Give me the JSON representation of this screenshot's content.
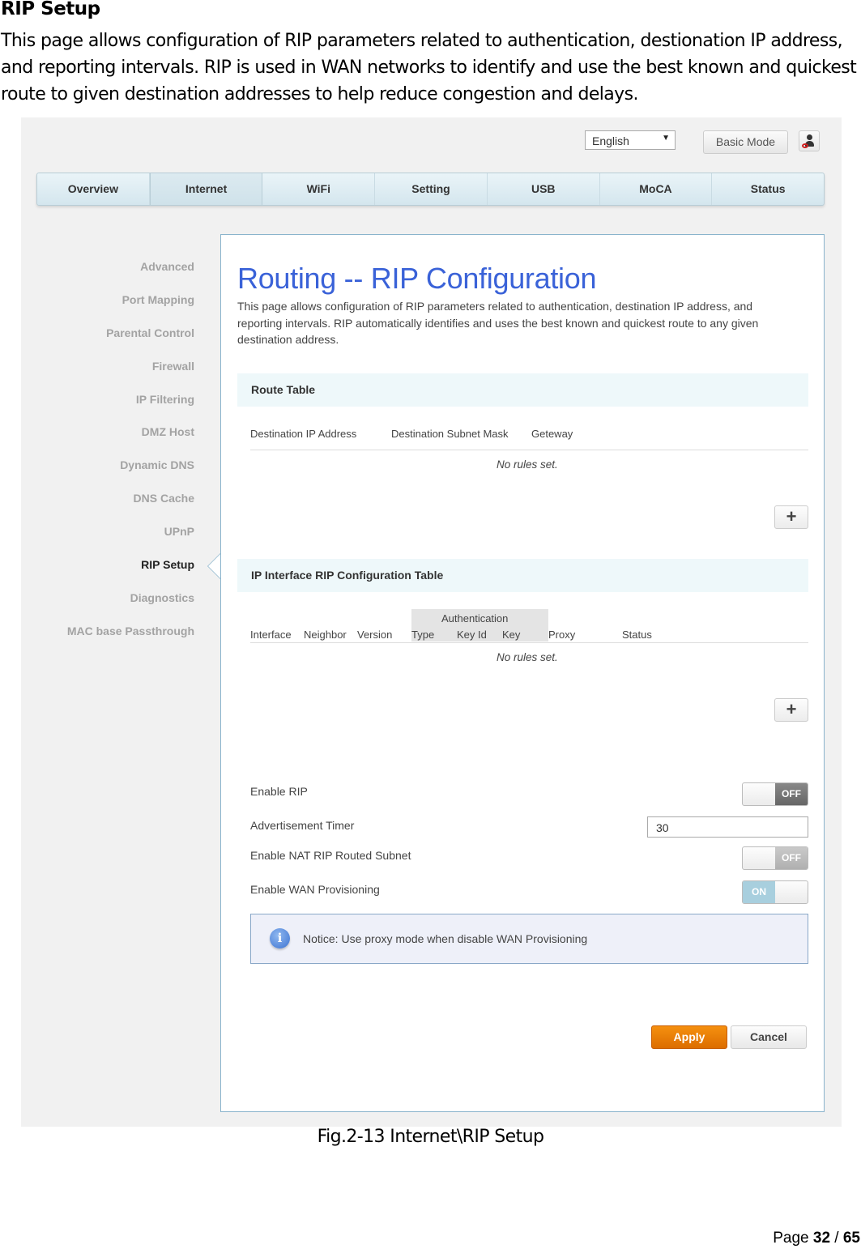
{
  "document": {
    "heading": "RIP Setup",
    "intro": "This page allows configuration of RIP parameters related to authentication, destionation IP address, and reporting intervals. RIP is used in WAN networks to identify and use the best known and quickest route to given destination addresses to help reduce congestion and delays.",
    "caption": "Fig.2-13 Internet\\RIP Setup",
    "page_label": "Page",
    "page_current": "32",
    "page_sep": "/",
    "page_total": "65"
  },
  "header": {
    "language": "English",
    "mode_button": "Basic Mode",
    "user_icon": "user-logout-icon"
  },
  "nav": {
    "tabs": [
      {
        "label": "Overview",
        "active": false
      },
      {
        "label": "Internet",
        "active": true
      },
      {
        "label": "WiFi",
        "active": false
      },
      {
        "label": "Setting",
        "active": false
      },
      {
        "label": "USB",
        "active": false
      },
      {
        "label": "MoCA",
        "active": false
      },
      {
        "label": "Status",
        "active": false
      }
    ]
  },
  "sidebar": {
    "items": [
      {
        "label": "Advanced"
      },
      {
        "label": "Port Mapping"
      },
      {
        "label": "Parental Control"
      },
      {
        "label": "Firewall"
      },
      {
        "label": "IP Filtering"
      },
      {
        "label": "DMZ Host"
      },
      {
        "label": "Dynamic DNS"
      },
      {
        "label": "DNS Cache"
      },
      {
        "label": "UPnP"
      },
      {
        "label": "RIP Setup",
        "active": true
      },
      {
        "label": "Diagnostics"
      },
      {
        "label": "MAC base Passthrough"
      }
    ]
  },
  "main": {
    "title": "Routing -- RIP Configuration",
    "description": "This page allows configuration of RIP parameters related to authentication, destination IP address, and reporting intervals. RIP automatically identifies and uses the best known and quickest route to any given destination address.",
    "route_table": {
      "title": "Route Table",
      "columns": [
        "Destination IP Address",
        "Destination Subnet Mask",
        "Geteway"
      ],
      "empty_text": "No rules set.",
      "add_icon": "plus-icon"
    },
    "rip_table": {
      "title": "IP Interface RIP Configuration Table",
      "group_header": "Authentication",
      "columns": [
        "Interface",
        "Neighbor",
        "Version",
        "Type",
        "Key Id",
        "Key",
        "Proxy",
        "Status"
      ],
      "empty_text": "No rules set.",
      "add_icon": "plus-icon"
    },
    "settings": {
      "enable_rip": {
        "label": "Enable RIP",
        "state": "OFF"
      },
      "advertisement_timer": {
        "label": "Advertisement Timer",
        "value": "30"
      },
      "enable_nat": {
        "label": "Enable NAT RIP Routed Subnet",
        "state": "OFF"
      },
      "enable_wan": {
        "label": "Enable WAN Provisioning",
        "state": "ON"
      }
    },
    "notice": {
      "icon": "info-icon",
      "text": "Notice: Use proxy mode when disable WAN Provisioning"
    },
    "buttons": {
      "apply": "Apply",
      "cancel": "Cancel"
    },
    "colors": {
      "title_blue": "#3a62d8",
      "apply_orange": "#e87a05",
      "section_bg": "#eef8fa"
    }
  }
}
